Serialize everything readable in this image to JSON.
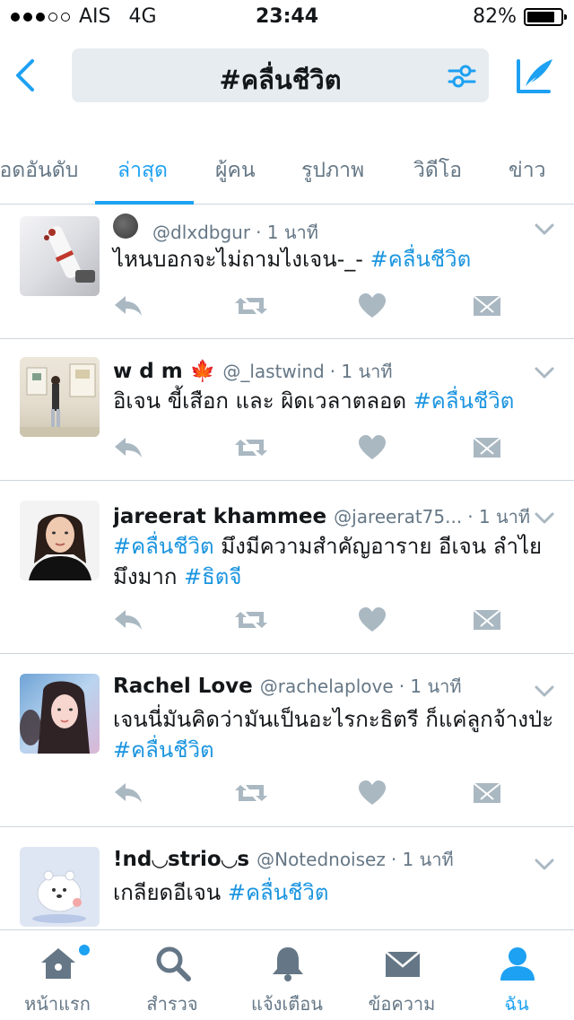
{
  "status_bar": {
    "carrier": "AIS",
    "network": "4G",
    "time": "23:44",
    "battery": "82%",
    "battery_level": 0.82
  },
  "header": {
    "search_query": "#คลื่นชีวิต"
  },
  "tabs": [
    {
      "label": "ยอดอันดับ"
    },
    {
      "label": "ล่าสุด"
    },
    {
      "label": "ผู้คน"
    },
    {
      "label": "รูปภาพ"
    },
    {
      "label": "วิดีโอ"
    },
    {
      "label": "ข่าว"
    }
  ],
  "active_tab": "ล่าสุด",
  "tweets": [
    {
      "name": "",
      "handle": "@dlxdbgur",
      "time": "· 1 นาที",
      "text": "ไหนบอกจะไม่ถามไงเจน-_-",
      "hashtags": [
        "#คลื่นชีวิต"
      ]
    },
    {
      "name": "w d m 🍁",
      "handle": "@_lastwind",
      "time": "· 1 นาที",
      "text": "อิเจน ขี้เสือก และ ผิดเวลาตลอด",
      "hashtags": [
        "#คลื่นชีวิต"
      ]
    },
    {
      "name": "jareerat khammee",
      "handle": "@jareerat75...",
      "time": "· 1 นาที",
      "hashtag_lead": "#คลื่นชีวิต",
      "text": "มึงมีความสำคัญอาราย อีเจน ลำไย มึงมาก",
      "hashtags": [
        "#ธิตจี"
      ]
    },
    {
      "name": "Rachel Love",
      "handle": "@rachelaplove",
      "time": "· 1 นาที",
      "text": "เจนนี่มันคิดว่ามันเป็นอะไรกะธิตรี ก็แค่ลูกจ้างป่ะ",
      "hashtags": [
        "#คลื่นชีวิต"
      ]
    },
    {
      "name": "!nd◡strio◡s",
      "handle": "@Notednoisez",
      "time": "· 1 นาที",
      "text": "เกลียดอีเจน",
      "hashtags": [
        "#คลื่นชีวิต"
      ]
    }
  ],
  "bottom_nav": [
    {
      "label": "หน้าแรก",
      "icon": "home-icon"
    },
    {
      "label": "สำรวจ",
      "icon": "search-icon"
    },
    {
      "label": "แจ้งเตือน",
      "icon": "bell-icon"
    },
    {
      "label": "ข้อความ",
      "icon": "mail-icon"
    },
    {
      "label": "ฉัน",
      "icon": "profile-icon"
    }
  ],
  "colors": {
    "accent": "#1da1f2",
    "icon_gray": "#aab8c2",
    "text_secondary": "#657786"
  }
}
